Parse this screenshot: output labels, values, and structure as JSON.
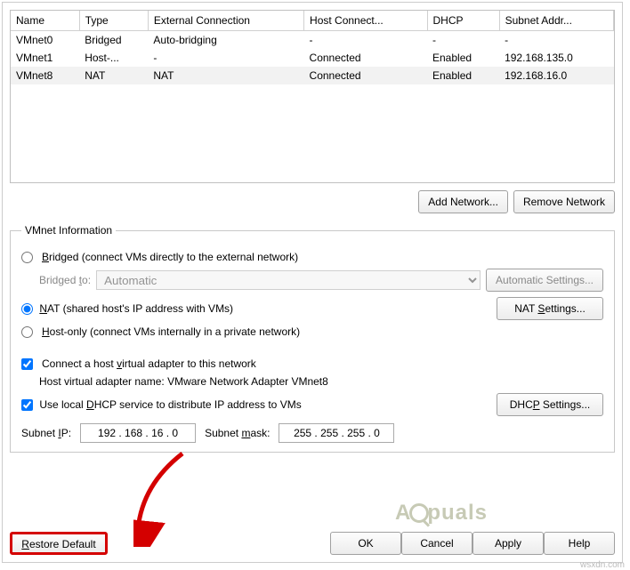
{
  "table": {
    "headers": [
      "Name",
      "Type",
      "External Connection",
      "Host Connect...",
      "DHCP",
      "Subnet Addr..."
    ],
    "rows": [
      {
        "name": "VMnet0",
        "type": "Bridged",
        "ext": "Auto-bridging",
        "host": "-",
        "dhcp": "-",
        "subnet": "-",
        "selected": false
      },
      {
        "name": "VMnet1",
        "type": "Host-...",
        "ext": "-",
        "host": "Connected",
        "dhcp": "Enabled",
        "subnet": "192.168.135.0",
        "selected": false
      },
      {
        "name": "VMnet8",
        "type": "NAT",
        "ext": "NAT",
        "host": "Connected",
        "dhcp": "Enabled",
        "subnet": "192.168.16.0",
        "selected": true
      }
    ]
  },
  "buttons": {
    "add_network": "Add Network...",
    "remove_network": "Remove Network",
    "automatic_settings": "Automatic Settings...",
    "nat_settings": "NAT Settings...",
    "dhcp_settings": "DHCP Settings...",
    "restore": "Restore Default",
    "ok": "OK",
    "cancel": "Cancel",
    "apply": "Apply",
    "help": "Help"
  },
  "info": {
    "legend": "VMnet Information",
    "bridged_label": "Bridged (connect VMs directly to the external network)",
    "bridged_to_label": "Bridged to:",
    "bridged_to_value": "Automatic",
    "nat_label": "NAT (shared host's IP address with VMs)",
    "hostonly_label": "Host-only (connect VMs internally in a private network)",
    "connect_adapter_label": "Connect a host virtual adapter to this network",
    "adapter_name_label": "Host virtual adapter name: VMware Network Adapter VMnet8",
    "dhcp_label": "Use local DHCP service to distribute IP address to VMs",
    "subnet_ip_label": "Subnet IP:",
    "subnet_ip_value": "192 . 168 . 16 . 0",
    "subnet_mask_label": "Subnet mask:",
    "subnet_mask_value": "255 . 255 . 255 . 0",
    "mode_selected": "nat",
    "connect_adapter_checked": true,
    "dhcp_checked": true
  },
  "watermark": {
    "brand_left": "A",
    "brand_right": "puals"
  },
  "source_note": "wsxdn.com"
}
